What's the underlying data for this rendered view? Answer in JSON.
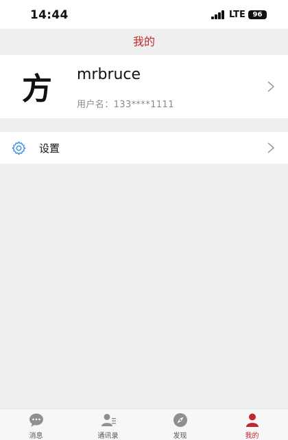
{
  "status_bar": {
    "time": "14:44",
    "network": "LTE",
    "battery": "96"
  },
  "header": {
    "title": "我的"
  },
  "profile": {
    "avatar_glyph": "方",
    "name": "mrbruce",
    "username": "用户名：133****1111"
  },
  "menu": {
    "settings_label": "设置"
  },
  "tab_bar": {
    "tabs": [
      {
        "label": "消息",
        "icon": "chat-bubble-icon"
      },
      {
        "label": "通讯录",
        "icon": "contacts-icon"
      },
      {
        "label": "发现",
        "icon": "compass-icon"
      },
      {
        "label": "我的",
        "icon": "person-icon"
      }
    ],
    "active": "我的"
  },
  "colors": {
    "accent": "#c0282d",
    "settings_icon": "#3a8ee6",
    "inactive_icon": "#8f8f8f"
  }
}
